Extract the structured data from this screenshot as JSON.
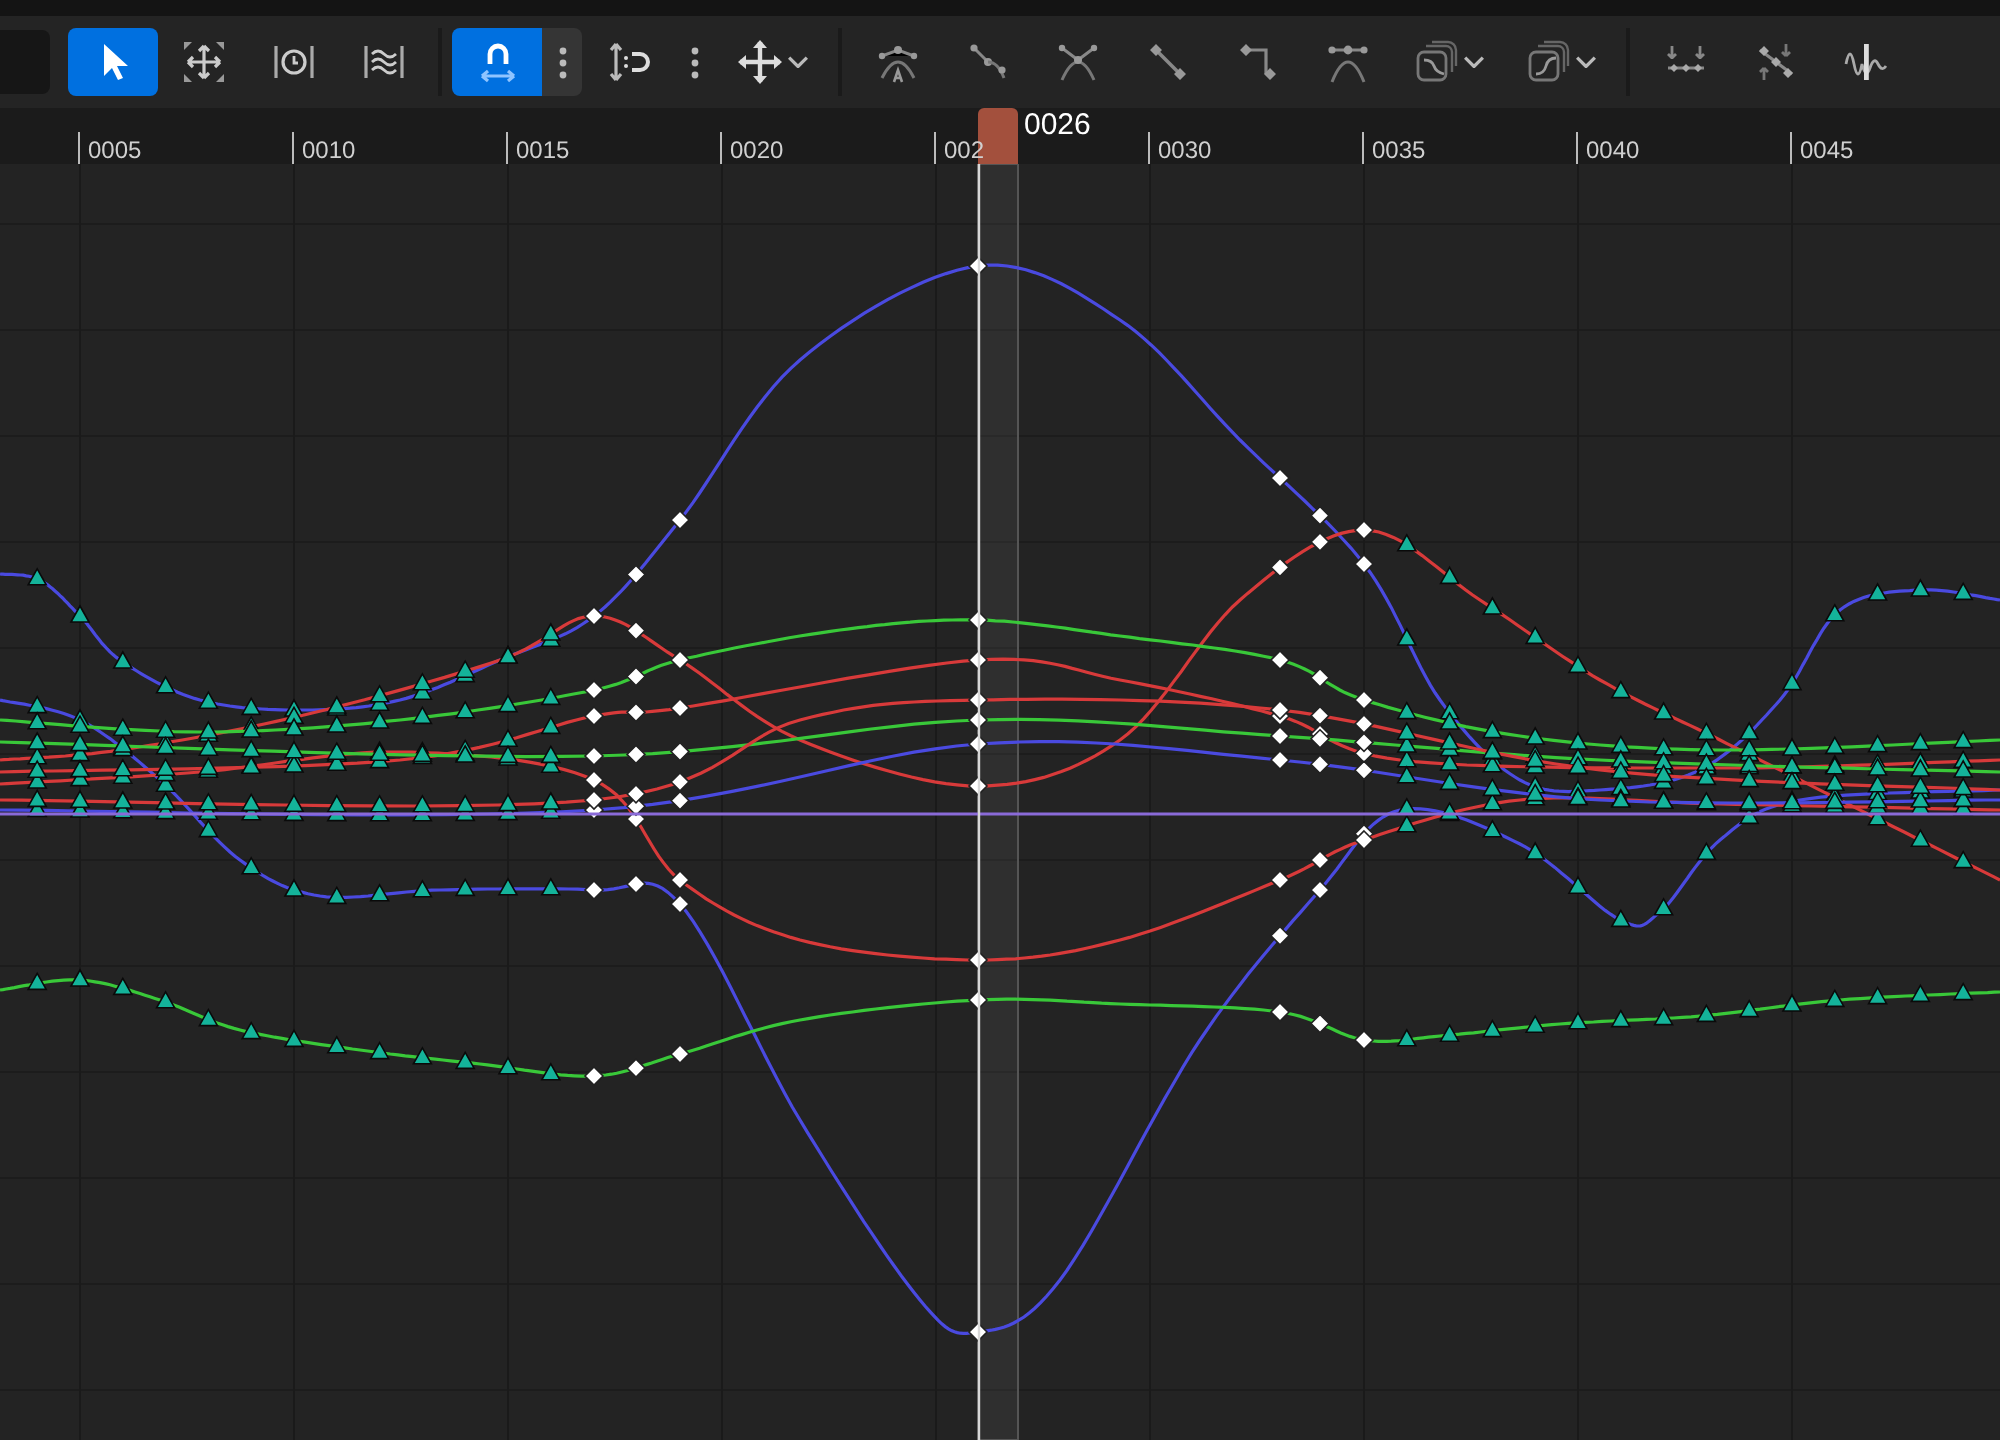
{
  "toolbar": {
    "groups": [
      {
        "tools": [
          {
            "kind": "pointer",
            "selected": true
          },
          {
            "kind": "transform",
            "selected": false
          },
          {
            "kind": "retime",
            "selected": false
          },
          {
            "kind": "wave",
            "selected": false
          }
        ]
      },
      {
        "tools": [
          {
            "kind": "magnet",
            "selected": true
          },
          {
            "kind": "more",
            "selected": false
          },
          {
            "kind": "snapline",
            "selected": false
          },
          {
            "kind": "more",
            "selected": false
          },
          {
            "kind": "move",
            "selected": false,
            "menu": true
          }
        ]
      },
      {
        "tools": [
          {
            "kind": "auto",
            "selected": false
          },
          {
            "kind": "user",
            "selected": false
          },
          {
            "kind": "broken",
            "selected": false
          },
          {
            "kind": "linear",
            "selected": false
          },
          {
            "kind": "step",
            "selected": false
          },
          {
            "kind": "weighted",
            "selected": false
          },
          {
            "kind": "preinf",
            "selected": false,
            "menu": true
          },
          {
            "kind": "postinf",
            "selected": false,
            "menu": true
          }
        ]
      },
      {
        "tools": [
          {
            "kind": "flatten",
            "selected": false
          },
          {
            "kind": "straighten",
            "selected": false
          },
          {
            "kind": "filter",
            "selected": false
          }
        ]
      }
    ]
  },
  "ruler": {
    "ticks": [
      "0005",
      "0010",
      "0015",
      "0020",
      "002",
      "0030",
      "0035",
      "0040",
      "0045"
    ],
    "playhead": {
      "frame": "0026"
    }
  }
}
